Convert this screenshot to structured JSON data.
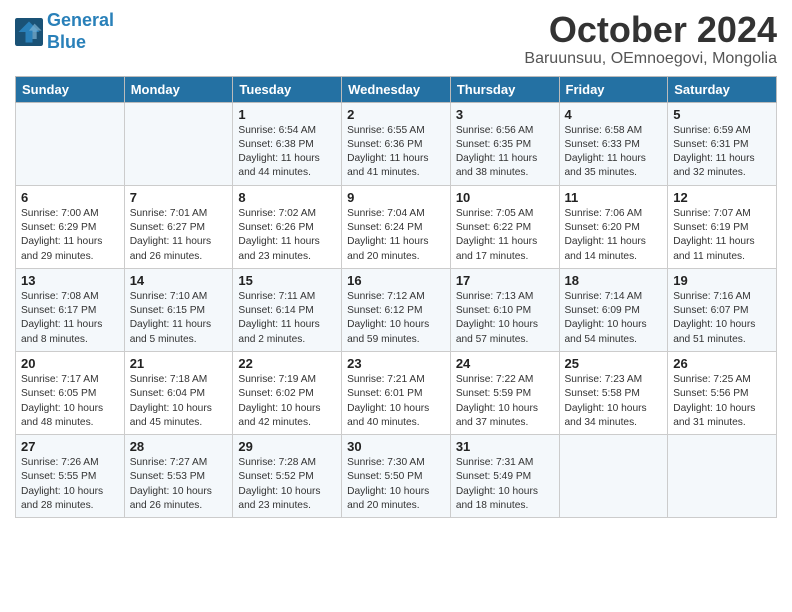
{
  "header": {
    "logo_line1": "General",
    "logo_line2": "Blue",
    "month_title": "October 2024",
    "subtitle": "Baruunsuu, OEmnoegovi, Mongolia"
  },
  "days_of_week": [
    "Sunday",
    "Monday",
    "Tuesday",
    "Wednesday",
    "Thursday",
    "Friday",
    "Saturday"
  ],
  "weeks": [
    [
      {
        "num": "",
        "info": ""
      },
      {
        "num": "",
        "info": ""
      },
      {
        "num": "1",
        "info": "Sunrise: 6:54 AM\nSunset: 6:38 PM\nDaylight: 11 hours and 44 minutes."
      },
      {
        "num": "2",
        "info": "Sunrise: 6:55 AM\nSunset: 6:36 PM\nDaylight: 11 hours and 41 minutes."
      },
      {
        "num": "3",
        "info": "Sunrise: 6:56 AM\nSunset: 6:35 PM\nDaylight: 11 hours and 38 minutes."
      },
      {
        "num": "4",
        "info": "Sunrise: 6:58 AM\nSunset: 6:33 PM\nDaylight: 11 hours and 35 minutes."
      },
      {
        "num": "5",
        "info": "Sunrise: 6:59 AM\nSunset: 6:31 PM\nDaylight: 11 hours and 32 minutes."
      }
    ],
    [
      {
        "num": "6",
        "info": "Sunrise: 7:00 AM\nSunset: 6:29 PM\nDaylight: 11 hours and 29 minutes."
      },
      {
        "num": "7",
        "info": "Sunrise: 7:01 AM\nSunset: 6:27 PM\nDaylight: 11 hours and 26 minutes."
      },
      {
        "num": "8",
        "info": "Sunrise: 7:02 AM\nSunset: 6:26 PM\nDaylight: 11 hours and 23 minutes."
      },
      {
        "num": "9",
        "info": "Sunrise: 7:04 AM\nSunset: 6:24 PM\nDaylight: 11 hours and 20 minutes."
      },
      {
        "num": "10",
        "info": "Sunrise: 7:05 AM\nSunset: 6:22 PM\nDaylight: 11 hours and 17 minutes."
      },
      {
        "num": "11",
        "info": "Sunrise: 7:06 AM\nSunset: 6:20 PM\nDaylight: 11 hours and 14 minutes."
      },
      {
        "num": "12",
        "info": "Sunrise: 7:07 AM\nSunset: 6:19 PM\nDaylight: 11 hours and 11 minutes."
      }
    ],
    [
      {
        "num": "13",
        "info": "Sunrise: 7:08 AM\nSunset: 6:17 PM\nDaylight: 11 hours and 8 minutes."
      },
      {
        "num": "14",
        "info": "Sunrise: 7:10 AM\nSunset: 6:15 PM\nDaylight: 11 hours and 5 minutes."
      },
      {
        "num": "15",
        "info": "Sunrise: 7:11 AM\nSunset: 6:14 PM\nDaylight: 11 hours and 2 minutes."
      },
      {
        "num": "16",
        "info": "Sunrise: 7:12 AM\nSunset: 6:12 PM\nDaylight: 10 hours and 59 minutes."
      },
      {
        "num": "17",
        "info": "Sunrise: 7:13 AM\nSunset: 6:10 PM\nDaylight: 10 hours and 57 minutes."
      },
      {
        "num": "18",
        "info": "Sunrise: 7:14 AM\nSunset: 6:09 PM\nDaylight: 10 hours and 54 minutes."
      },
      {
        "num": "19",
        "info": "Sunrise: 7:16 AM\nSunset: 6:07 PM\nDaylight: 10 hours and 51 minutes."
      }
    ],
    [
      {
        "num": "20",
        "info": "Sunrise: 7:17 AM\nSunset: 6:05 PM\nDaylight: 10 hours and 48 minutes."
      },
      {
        "num": "21",
        "info": "Sunrise: 7:18 AM\nSunset: 6:04 PM\nDaylight: 10 hours and 45 minutes."
      },
      {
        "num": "22",
        "info": "Sunrise: 7:19 AM\nSunset: 6:02 PM\nDaylight: 10 hours and 42 minutes."
      },
      {
        "num": "23",
        "info": "Sunrise: 7:21 AM\nSunset: 6:01 PM\nDaylight: 10 hours and 40 minutes."
      },
      {
        "num": "24",
        "info": "Sunrise: 7:22 AM\nSunset: 5:59 PM\nDaylight: 10 hours and 37 minutes."
      },
      {
        "num": "25",
        "info": "Sunrise: 7:23 AM\nSunset: 5:58 PM\nDaylight: 10 hours and 34 minutes."
      },
      {
        "num": "26",
        "info": "Sunrise: 7:25 AM\nSunset: 5:56 PM\nDaylight: 10 hours and 31 minutes."
      }
    ],
    [
      {
        "num": "27",
        "info": "Sunrise: 7:26 AM\nSunset: 5:55 PM\nDaylight: 10 hours and 28 minutes."
      },
      {
        "num": "28",
        "info": "Sunrise: 7:27 AM\nSunset: 5:53 PM\nDaylight: 10 hours and 26 minutes."
      },
      {
        "num": "29",
        "info": "Sunrise: 7:28 AM\nSunset: 5:52 PM\nDaylight: 10 hours and 23 minutes."
      },
      {
        "num": "30",
        "info": "Sunrise: 7:30 AM\nSunset: 5:50 PM\nDaylight: 10 hours and 20 minutes."
      },
      {
        "num": "31",
        "info": "Sunrise: 7:31 AM\nSunset: 5:49 PM\nDaylight: 10 hours and 18 minutes."
      },
      {
        "num": "",
        "info": ""
      },
      {
        "num": "",
        "info": ""
      }
    ]
  ]
}
